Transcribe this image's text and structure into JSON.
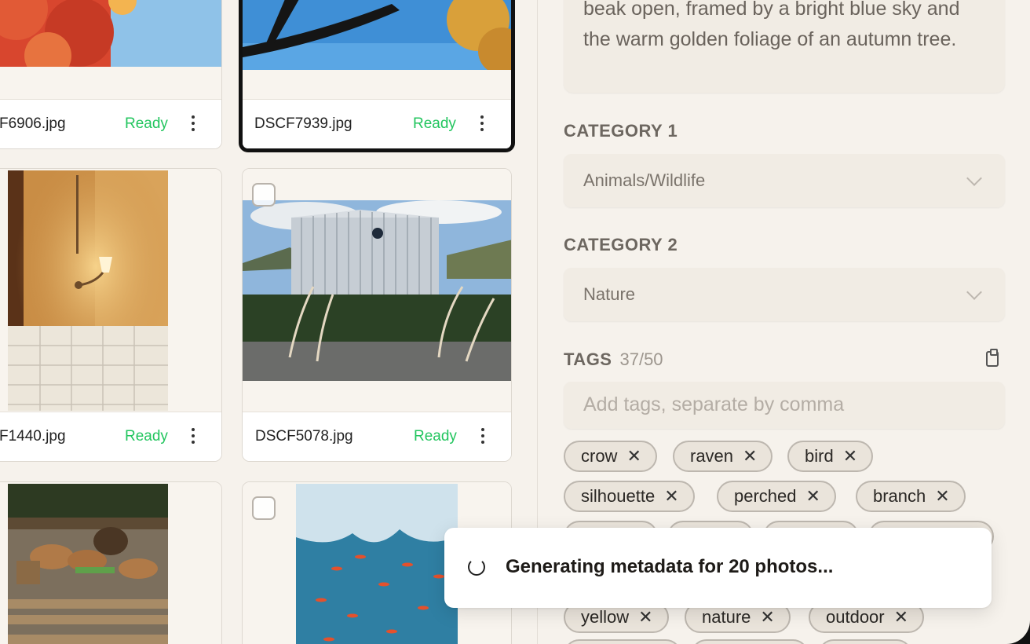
{
  "grid": {
    "cards": [
      {
        "filename": "F6906.jpg",
        "status": "Ready"
      },
      {
        "filename": "DSCF7939.jpg",
        "status": "Ready"
      },
      {
        "filename": "F1440.jpg",
        "status": "Ready"
      },
      {
        "filename": "DSCF5078.jpg",
        "status": "Ready"
      },
      {
        "filename": "",
        "status": ""
      },
      {
        "filename": "",
        "status": ""
      }
    ]
  },
  "panel": {
    "description": "beak open, framed by a bright blue sky and the warm golden foliage of an autumn tree.",
    "category1": {
      "label": "CATEGORY 1",
      "value": "Animals/Wildlife"
    },
    "category2": {
      "label": "CATEGORY 2",
      "value": "Nature"
    },
    "tags": {
      "label": "TAGS",
      "count": "37/50",
      "placeholder": "Add tags, separate by comma",
      "items": [
        "crow",
        "raven",
        "bird",
        "silhouette",
        "perched",
        "branch",
        "yellow",
        "nature",
        "outdoor"
      ]
    }
  },
  "toast": {
    "message": "Generating metadata for 20 photos..."
  },
  "colors": {
    "ready": "#22c55e",
    "background": "#f6f2ec",
    "accent": "#111111"
  },
  "icons": {
    "card_menu": "kebab-icon",
    "select": "chevron-down-icon",
    "tags_copy": "clipboard-icon",
    "tag_remove": "close-icon",
    "loading": "spinner-icon"
  }
}
